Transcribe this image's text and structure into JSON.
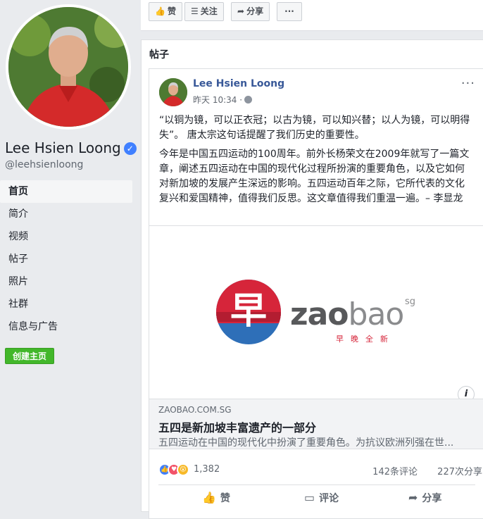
{
  "colors": {
    "accent": "#385898",
    "green": "#42b72a",
    "bg": "#e9ebee"
  },
  "profile": {
    "name": "Lee Hsien Loong",
    "handle": "@leehsienloong",
    "verified_icon": "verified-badge-icon"
  },
  "sidebar": {
    "items": [
      {
        "label": "首页",
        "active": true
      },
      {
        "label": "简介"
      },
      {
        "label": "视频"
      },
      {
        "label": "帖子"
      },
      {
        "label": "照片"
      },
      {
        "label": "社群"
      },
      {
        "label": "信息与广告"
      }
    ],
    "create_button": "创建主页"
  },
  "actionbar": {
    "like": "赞",
    "follow": "关注",
    "share": "分享",
    "more": "···"
  },
  "posts": {
    "section_title": "帖子",
    "post": {
      "author": "Lee Hsien Loong",
      "time": "昨天 10:34 ·",
      "more": "···",
      "paragraph1": "“以铜为镜，可以正衣冠；以古为镜，可以知兴替；以人为镜，可以明得失”。 唐太宗这句话提醒了我们历史的重要性。",
      "paragraph2": "今年是中国五四运动的100周年。前外长杨荣文在2009年就写了一篇文章，阐述五四运动在中国的现代化过程所扮演的重要角色，以及它如何对新加坡的发展产生深远的影响。五四运动百年之际，它所代表的文化复兴和爱国精神，值得我们反思。这文章值得我们重温一遍。– 李显龙",
      "link": {
        "logo_char": "早",
        "logo_word_dark": "zao",
        "logo_word_light": "bao",
        "logo_suffix": "sg",
        "logo_sub": "早晚全新",
        "info": "i",
        "domain": "ZAOBAO.COM.SG",
        "title": "五四是新加坡丰富遗产的一部分",
        "description": "五四运动在中国的现代化中扮演了重要角色。为抗议欧洲列强在世..."
      },
      "reactions": {
        "count": "1,382",
        "comments": "142条评论",
        "shares": "227次分享"
      },
      "actions": {
        "like": "赞",
        "comment": "评论",
        "share": "分享"
      }
    }
  }
}
